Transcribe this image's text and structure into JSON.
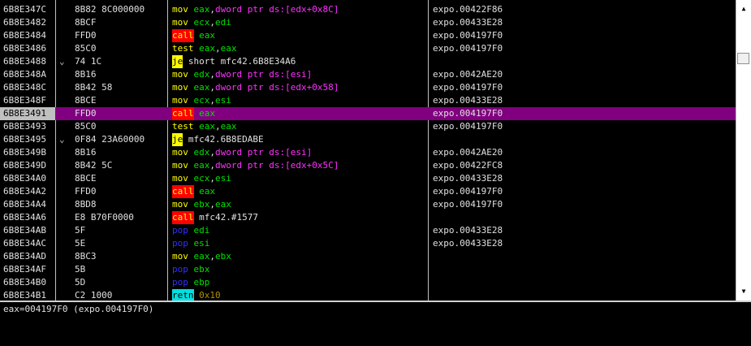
{
  "disassembly": {
    "rows": [
      {
        "addr": "6B8E347C",
        "arrow": "",
        "bytes": "8B82 8C000000",
        "mnemonic": "mov",
        "mtype": "mov",
        "ops": [
          {
            "t": "eax",
            "c": "reg"
          },
          {
            "t": ",",
            "c": "plain"
          },
          {
            "t": "dword ptr ds:[edx+0x8C]",
            "c": "mem"
          }
        ],
        "comment": "expo.00422F86"
      },
      {
        "addr": "6B8E3482",
        "arrow": "",
        "bytes": "8BCF",
        "mnemonic": "mov",
        "mtype": "mov",
        "ops": [
          {
            "t": "ecx",
            "c": "reg"
          },
          {
            "t": ",",
            "c": "plain"
          },
          {
            "t": "edi",
            "c": "reg"
          }
        ],
        "comment": "expo.00433E28"
      },
      {
        "addr": "6B8E3484",
        "arrow": "",
        "bytes": "FFD0",
        "mnemonic": "call",
        "mtype": "call",
        "ops": [
          {
            "t": "eax",
            "c": "reg"
          }
        ],
        "comment": "expo.004197F0"
      },
      {
        "addr": "6B8E3486",
        "arrow": "",
        "bytes": "85C0",
        "mnemonic": "test",
        "mtype": "test",
        "ops": [
          {
            "t": "eax",
            "c": "reg"
          },
          {
            "t": ",",
            "c": "plain"
          },
          {
            "t": "eax",
            "c": "reg"
          }
        ],
        "comment": "expo.004197F0"
      },
      {
        "addr": "6B8E3488",
        "arrow": "⌄",
        "bytes": "74 1C",
        "mnemonic": "je",
        "mtype": "je",
        "ops": [
          {
            "t": "short mfc42.6B8E34A6",
            "c": "plain"
          }
        ],
        "comment": ""
      },
      {
        "addr": "6B8E348A",
        "arrow": "",
        "bytes": "8B16",
        "mnemonic": "mov",
        "mtype": "mov",
        "ops": [
          {
            "t": "edx",
            "c": "reg"
          },
          {
            "t": ",",
            "c": "plain"
          },
          {
            "t": "dword ptr ds:[esi]",
            "c": "mem"
          }
        ],
        "comment": "expo.0042AE20"
      },
      {
        "addr": "6B8E348C",
        "arrow": "",
        "bytes": "8B42 58",
        "mnemonic": "mov",
        "mtype": "mov",
        "ops": [
          {
            "t": "eax",
            "c": "reg"
          },
          {
            "t": ",",
            "c": "plain"
          },
          {
            "t": "dword ptr ds:[edx+0x58]",
            "c": "mem"
          }
        ],
        "comment": "expo.004197F0"
      },
      {
        "addr": "6B8E348F",
        "arrow": "",
        "bytes": "8BCE",
        "mnemonic": "mov",
        "mtype": "mov",
        "ops": [
          {
            "t": "ecx",
            "c": "reg"
          },
          {
            "t": ",",
            "c": "plain"
          },
          {
            "t": "esi",
            "c": "reg"
          }
        ],
        "comment": "expo.00433E28"
      },
      {
        "addr": "6B8E3491",
        "arrow": "",
        "bytes": "FFD0",
        "mnemonic": "call",
        "mtype": "call",
        "ops": [
          {
            "t": "eax",
            "c": "reg"
          }
        ],
        "comment": "expo.004197F0",
        "selected": true
      },
      {
        "addr": "6B8E3493",
        "arrow": "",
        "bytes": "85C0",
        "mnemonic": "test",
        "mtype": "test",
        "ops": [
          {
            "t": "eax",
            "c": "reg"
          },
          {
            "t": ",",
            "c": "plain"
          },
          {
            "t": "eax",
            "c": "reg"
          }
        ],
        "comment": "expo.004197F0"
      },
      {
        "addr": "6B8E3495",
        "arrow": "⌄",
        "bytes": "0F84 23A60000",
        "mnemonic": "je",
        "mtype": "je",
        "ops": [
          {
            "t": "mfc42.6B8EDABE",
            "c": "plain"
          }
        ],
        "comment": ""
      },
      {
        "addr": "6B8E349B",
        "arrow": "",
        "bytes": "8B16",
        "mnemonic": "mov",
        "mtype": "mov",
        "ops": [
          {
            "t": "edx",
            "c": "reg"
          },
          {
            "t": ",",
            "c": "plain"
          },
          {
            "t": "dword ptr ds:[esi]",
            "c": "mem"
          }
        ],
        "comment": "expo.0042AE20"
      },
      {
        "addr": "6B8E349D",
        "arrow": "",
        "bytes": "8B42 5C",
        "mnemonic": "mov",
        "mtype": "mov",
        "ops": [
          {
            "t": "eax",
            "c": "reg"
          },
          {
            "t": ",",
            "c": "plain"
          },
          {
            "t": "dword ptr ds:[edx+0x5C]",
            "c": "mem"
          }
        ],
        "comment": "expo.00422FC8"
      },
      {
        "addr": "6B8E34A0",
        "arrow": "",
        "bytes": "8BCE",
        "mnemonic": "mov",
        "mtype": "mov",
        "ops": [
          {
            "t": "ecx",
            "c": "reg"
          },
          {
            "t": ",",
            "c": "plain"
          },
          {
            "t": "esi",
            "c": "reg"
          }
        ],
        "comment": "expo.00433E28"
      },
      {
        "addr": "6B8E34A2",
        "arrow": "",
        "bytes": "FFD0",
        "mnemonic": "call",
        "mtype": "call",
        "ops": [
          {
            "t": "eax",
            "c": "reg"
          }
        ],
        "comment": "expo.004197F0"
      },
      {
        "addr": "6B8E34A4",
        "arrow": "",
        "bytes": "8BD8",
        "mnemonic": "mov",
        "mtype": "mov",
        "ops": [
          {
            "t": "ebx",
            "c": "reg"
          },
          {
            "t": ",",
            "c": "plain"
          },
          {
            "t": "eax",
            "c": "reg"
          }
        ],
        "comment": "expo.004197F0"
      },
      {
        "addr": "6B8E34A6",
        "arrow": "",
        "bytes": "E8 B70F0000",
        "mnemonic": "call",
        "mtype": "call",
        "ops": [
          {
            "t": "mfc42.#1577",
            "c": "plain"
          }
        ],
        "comment": ""
      },
      {
        "addr": "6B8E34AB",
        "arrow": "",
        "bytes": "5F",
        "mnemonic": "pop",
        "mtype": "pop",
        "ops": [
          {
            "t": "edi",
            "c": "reg"
          }
        ],
        "comment": "expo.00433E28"
      },
      {
        "addr": "6B8E34AC",
        "arrow": "",
        "bytes": "5E",
        "mnemonic": "pop",
        "mtype": "pop",
        "ops": [
          {
            "t": "esi",
            "c": "reg"
          }
        ],
        "comment": "expo.00433E28"
      },
      {
        "addr": "6B8E34AD",
        "arrow": "",
        "bytes": "8BC3",
        "mnemonic": "mov",
        "mtype": "mov",
        "ops": [
          {
            "t": "eax",
            "c": "reg"
          },
          {
            "t": ",",
            "c": "plain"
          },
          {
            "t": "ebx",
            "c": "reg"
          }
        ],
        "comment": ""
      },
      {
        "addr": "6B8E34AF",
        "arrow": "",
        "bytes": "5B",
        "mnemonic": "pop",
        "mtype": "pop",
        "ops": [
          {
            "t": "ebx",
            "c": "reg"
          }
        ],
        "comment": ""
      },
      {
        "addr": "6B8E34B0",
        "arrow": "",
        "bytes": "5D",
        "mnemonic": "pop",
        "mtype": "pop",
        "ops": [
          {
            "t": "ebp",
            "c": "reg"
          }
        ],
        "comment": ""
      },
      {
        "addr": "6B8E34B1",
        "arrow": "",
        "bytes": "C2 1000",
        "mnemonic": "retn",
        "mtype": "retn",
        "ops": [
          {
            "t": "0x10",
            "c": "imm"
          }
        ],
        "comment": ""
      }
    ]
  },
  "scrollbar": {
    "up_icon": "▲",
    "down_icon": "▼"
  },
  "info_pane": {
    "text": "eax=004197F0 (expo.004197F0)"
  },
  "colors": {
    "background": "#000000",
    "selected_row": "#800080",
    "register": "#00e000",
    "memory_operand": "#ff30ff",
    "mnemonic": "#ffff00",
    "call_highlight": "#ff0000",
    "jump_highlight": "#ffff00",
    "return_highlight": "#00e0e0",
    "pop": "#3030ff"
  }
}
